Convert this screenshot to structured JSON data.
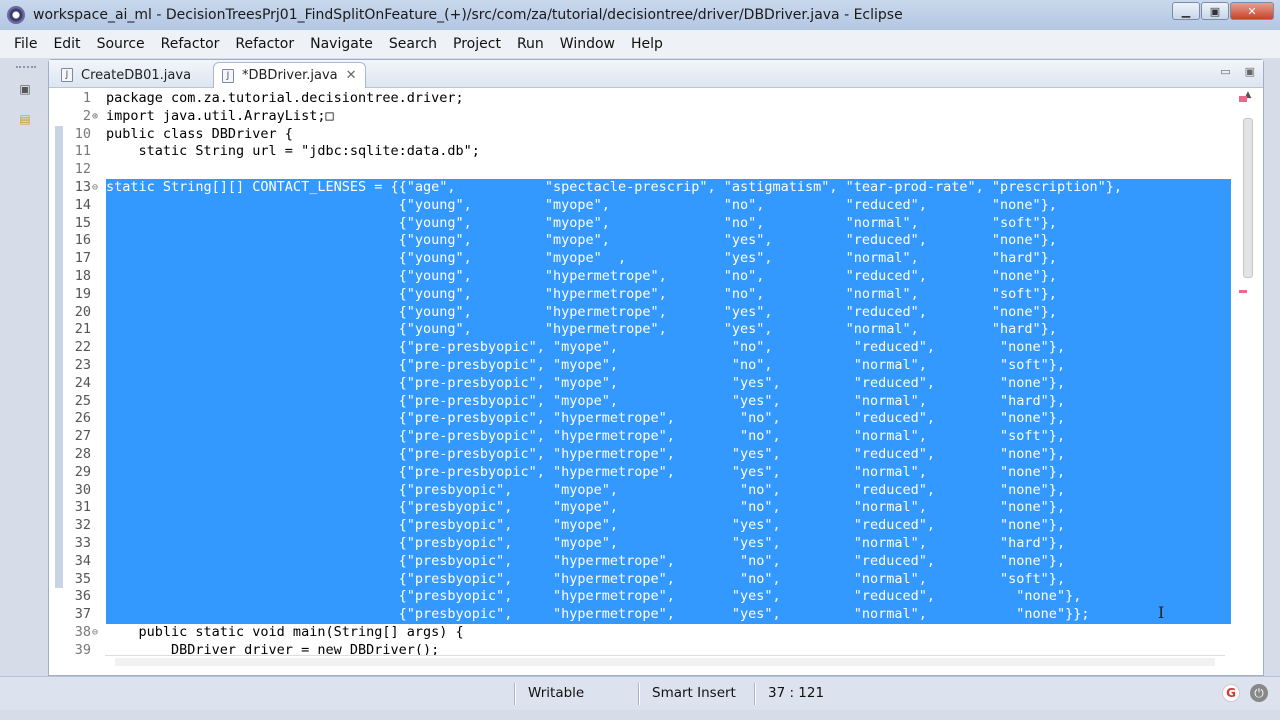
{
  "window": {
    "title": "workspace_ai_ml - DecisionTreesPrj01_FindSplitOnFeature_(+)/src/com/za/tutorial/decisiontree/driver/DBDriver.java - Eclipse",
    "min_label": "▭",
    "max_label": "▣",
    "close_label": "✕"
  },
  "menu": [
    "File",
    "Edit",
    "Source",
    "Refactor",
    "Refactor",
    "Navigate",
    "Search",
    "Project",
    "Run",
    "Window",
    "Help"
  ],
  "tabs": [
    {
      "label": "CreateDB01.java",
      "icon": "J"
    },
    {
      "label": "*DBDriver.java",
      "icon": "J",
      "close": "✕"
    }
  ],
  "code_lines": [
    {
      "n": "1",
      "fold": "",
      "text": "package com.za.tutorial.decisiontree.driver;"
    },
    {
      "n": "2",
      "fold": "⊕",
      "text": "import java.util.ArrayList;□"
    },
    {
      "n": "10",
      "fold": "",
      "text": "public class DBDriver {"
    },
    {
      "n": "11",
      "fold": "",
      "text": "    static String url = \"jdbc:sqlite:data.db\";"
    },
    {
      "n": "12",
      "fold": "",
      "text": ""
    },
    {
      "n": "13",
      "fold": "⊖",
      "text": "static String[][] CONTACT_LENSES = {{\"age\",           \"spectacle-prescrip\", \"astigmatism\", \"tear-prod-rate\", \"prescription\"},"
    },
    {
      "n": "14",
      "fold": "",
      "text": "                                    {\"young\",         \"myope\",              \"no\",          \"reduced\",        \"none\"},"
    },
    {
      "n": "15",
      "fold": "",
      "text": "                                    {\"young\",         \"myope\",              \"no\",          \"normal\",         \"soft\"},"
    },
    {
      "n": "16",
      "fold": "",
      "text": "                                    {\"young\",         \"myope\",              \"yes\",         \"reduced\",        \"none\"},"
    },
    {
      "n": "17",
      "fold": "",
      "text": "                                    {\"young\",         \"myope\"  ,            \"yes\",         \"normal\",         \"hard\"},"
    },
    {
      "n": "18",
      "fold": "",
      "text": "                                    {\"young\",         \"hypermetrope\",       \"no\",          \"reduced\",        \"none\"},"
    },
    {
      "n": "19",
      "fold": "",
      "text": "                                    {\"young\",         \"hypermetrope\",       \"no\",          \"normal\",         \"soft\"},"
    },
    {
      "n": "20",
      "fold": "",
      "text": "                                    {\"young\",         \"hypermetrope\",       \"yes\",         \"reduced\",        \"none\"},"
    },
    {
      "n": "21",
      "fold": "",
      "text": "                                    {\"young\",         \"hypermetrope\",       \"yes\",         \"normal\",         \"hard\"},"
    },
    {
      "n": "22",
      "fold": "",
      "text": "                                    {\"pre-presbyopic\", \"myope\",              \"no\",          \"reduced\",        \"none\"},"
    },
    {
      "n": "23",
      "fold": "",
      "text": "                                    {\"pre-presbyopic\", \"myope\",              \"no\",          \"normal\",         \"soft\"},"
    },
    {
      "n": "24",
      "fold": "",
      "text": "                                    {\"pre-presbyopic\", \"myope\",              \"yes\",         \"reduced\",        \"none\"},"
    },
    {
      "n": "25",
      "fold": "",
      "text": "                                    {\"pre-presbyopic\", \"myope\",              \"yes\",         \"normal\",         \"hard\"},"
    },
    {
      "n": "26",
      "fold": "",
      "text": "                                    {\"pre-presbyopic\", \"hypermetrope\",        \"no\",         \"reduced\",        \"none\"},"
    },
    {
      "n": "27",
      "fold": "",
      "text": "                                    {\"pre-presbyopic\", \"hypermetrope\",        \"no\",         \"normal\",         \"soft\"},"
    },
    {
      "n": "28",
      "fold": "",
      "text": "                                    {\"pre-presbyopic\", \"hypermetrope\",       \"yes\",         \"reduced\",        \"none\"},"
    },
    {
      "n": "29",
      "fold": "",
      "text": "                                    {\"pre-presbyopic\", \"hypermetrope\",       \"yes\",         \"normal\",         \"none\"},"
    },
    {
      "n": "30",
      "fold": "",
      "text": "                                    {\"presbyopic\",     \"myope\",               \"no\",         \"reduced\",        \"none\"},"
    },
    {
      "n": "31",
      "fold": "",
      "text": "                                    {\"presbyopic\",     \"myope\",               \"no\",         \"normal\",         \"none\"},"
    },
    {
      "n": "32",
      "fold": "",
      "text": "                                    {\"presbyopic\",     \"myope\",              \"yes\",         \"reduced\",        \"none\"},"
    },
    {
      "n": "33",
      "fold": "",
      "text": "                                    {\"presbyopic\",     \"myope\",              \"yes\",         \"normal\",         \"hard\"},"
    },
    {
      "n": "34",
      "fold": "",
      "text": "                                    {\"presbyopic\",     \"hypermetrope\",        \"no\",         \"reduced\",        \"none\"},"
    },
    {
      "n": "35",
      "fold": "",
      "text": "                                    {\"presbyopic\",     \"hypermetrope\",        \"no\",         \"normal\",         \"soft\"},"
    },
    {
      "n": "36",
      "fold": "",
      "text": "                                    {\"presbyopic\",     \"hypermetrope\",       \"yes\",         \"reduced\",          \"none\"},"
    },
    {
      "n": "37",
      "fold": "",
      "text": "                                    {\"presbyopic\",     \"hypermetrope\",       \"yes\",         \"normal\",           \"none\"}};"
    },
    {
      "n": "38",
      "fold": "⊖",
      "text": "    public static void main(String[] args) {"
    },
    {
      "n": "39",
      "fold": "",
      "text": "        DBDriver driver = new DBDriver();"
    }
  ],
  "status": {
    "writable": "Writable",
    "insert_mode": "Smart Insert",
    "position": "37 : 121"
  },
  "colors": {
    "selection": "#3399ff",
    "keyword": "#7f0055",
    "string": "#2a00ff"
  }
}
